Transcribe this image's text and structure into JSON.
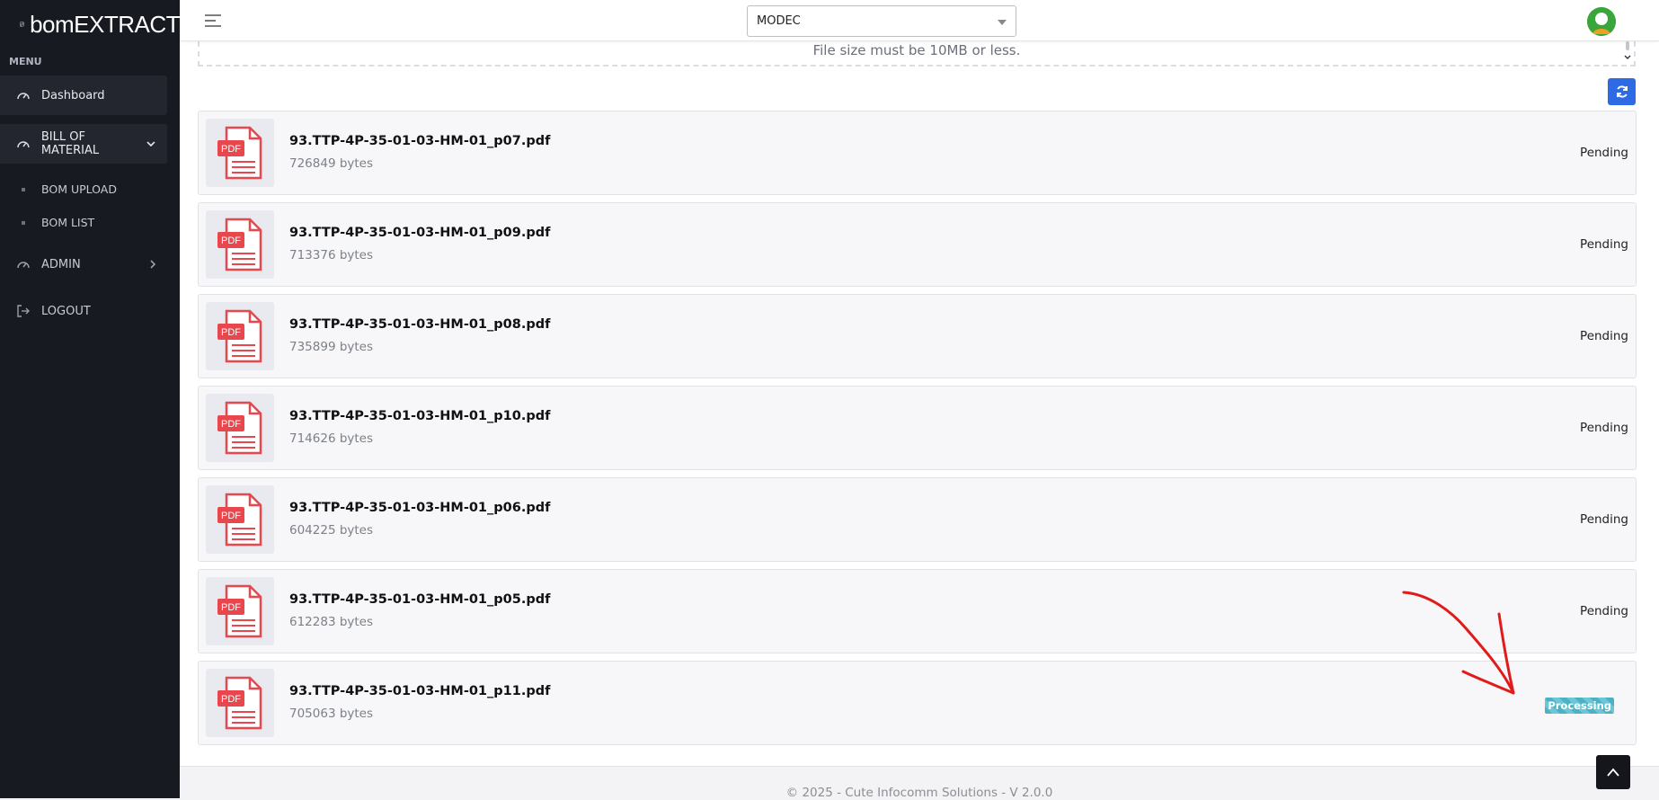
{
  "app": {
    "brand": "bomEXTRACT"
  },
  "sidebar": {
    "menu_label": "MENU",
    "items": [
      {
        "label": "Dashboard"
      },
      {
        "label": "BILL OF MATERIAL"
      },
      {
        "label": "BOM UPLOAD"
      },
      {
        "label": "BOM LIST"
      },
      {
        "label": "ADMIN"
      },
      {
        "label": "LOGOUT"
      }
    ]
  },
  "header": {
    "company_select": "MODEC"
  },
  "upload": {
    "note": "File size must be 10MB or less."
  },
  "files": [
    {
      "name": "93.TTP-4P-35-01-03-HM-01_p07.pdf",
      "size": "726849 bytes",
      "status": "Pending"
    },
    {
      "name": "93.TTP-4P-35-01-03-HM-01_p09.pdf",
      "size": "713376 bytes",
      "status": "Pending"
    },
    {
      "name": "93.TTP-4P-35-01-03-HM-01_p08.pdf",
      "size": "735899 bytes",
      "status": "Pending"
    },
    {
      "name": "93.TTP-4P-35-01-03-HM-01_p10.pdf",
      "size": "714626 bytes",
      "status": "Pending"
    },
    {
      "name": "93.TTP-4P-35-01-03-HM-01_p06.pdf",
      "size": "604225 bytes",
      "status": "Pending"
    },
    {
      "name": "93.TTP-4P-35-01-03-HM-01_p05.pdf",
      "size": "612283 bytes",
      "status": "Pending"
    },
    {
      "name": "93.TTP-4P-35-01-03-HM-01_p11.pdf",
      "size": "705063 bytes",
      "status": "Processing"
    }
  ],
  "file_icon_label": "PDF",
  "footer": {
    "text": "© 2025 - Cute Infocomm Solutions - V 2.0.0"
  },
  "colors": {
    "sidebar_bg": "#171a21",
    "accent_blue": "#2d6ae3",
    "pdf_red": "#e8474e",
    "processing": "#4bb2c4",
    "annotation_red": "#e01b1b"
  }
}
